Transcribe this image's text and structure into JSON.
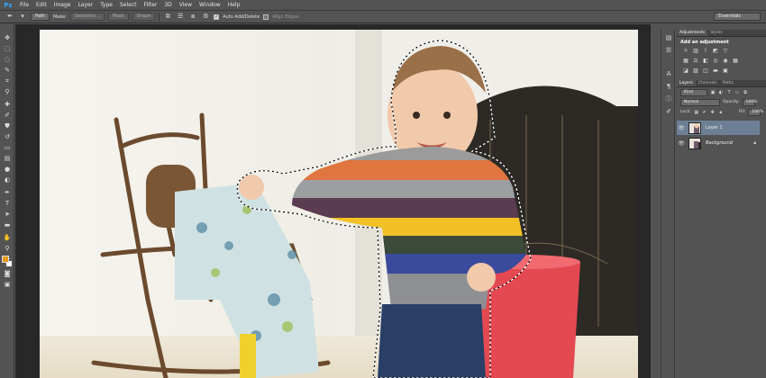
{
  "app": {
    "logo": "Ps"
  },
  "menu": [
    "File",
    "Edit",
    "Image",
    "Layer",
    "Type",
    "Select",
    "Filter",
    "3D",
    "View",
    "Window",
    "Help"
  ],
  "options": {
    "mode": "Path",
    "make_label": "Make:",
    "selection_btn": "Selection...",
    "mask_btn": "Mask",
    "shape_btn": "Shape",
    "auto_add_delete": "Auto Add/Delete",
    "align_edges": "Align Edges",
    "workspace": "Essentials"
  },
  "panels": {
    "adjustments_tab": "Adjustments",
    "styles_tab": "Styles",
    "add_adjustment": "Add an adjustment",
    "layers_tab": "Layers",
    "channels_tab": "Channels",
    "paths_tab": "Paths",
    "kind": "Kind",
    "blend_mode": "Normal",
    "opacity_label": "Opacity:",
    "opacity_value": "100%",
    "lock_label": "Lock:",
    "fill_label": "Fill:",
    "fill_value": "100%",
    "layers": [
      {
        "name": "Layer 1",
        "selected": true
      },
      {
        "name": "Background",
        "selected": false
      }
    ]
  },
  "colors": {
    "foreground": "#e59a13",
    "background": "#ffffff",
    "selected_layer": "#6c7f95"
  }
}
